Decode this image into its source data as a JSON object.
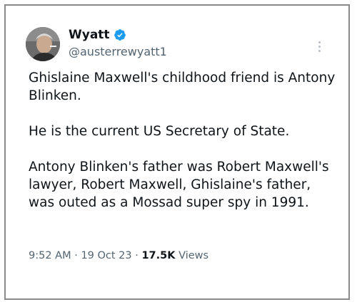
{
  "author": {
    "display_name": "Wyatt",
    "handle": "@austerrewyatt1",
    "verified": true
  },
  "tweet": {
    "paragraphs": [
      "Ghislaine Maxwell's childhood friend is Antony Blinken.",
      "He is the current US Secretary of State.",
      "Antony Blinken's father was Robert Maxwell's lawyer, Robert Maxwell, Ghislaine's father, was outed as a Mossad super spy in 1991."
    ]
  },
  "meta": {
    "time": "9:52 AM",
    "separator": "·",
    "date": "19 Oct 23",
    "views_count": "17.5K",
    "views_label": "Views"
  },
  "colors": {
    "text": "#0f1419",
    "secondary": "#536471",
    "verified_badge": "#1d9bf0"
  },
  "icons": {
    "verified": "verified-badge-icon",
    "more": "more-options-icon"
  }
}
